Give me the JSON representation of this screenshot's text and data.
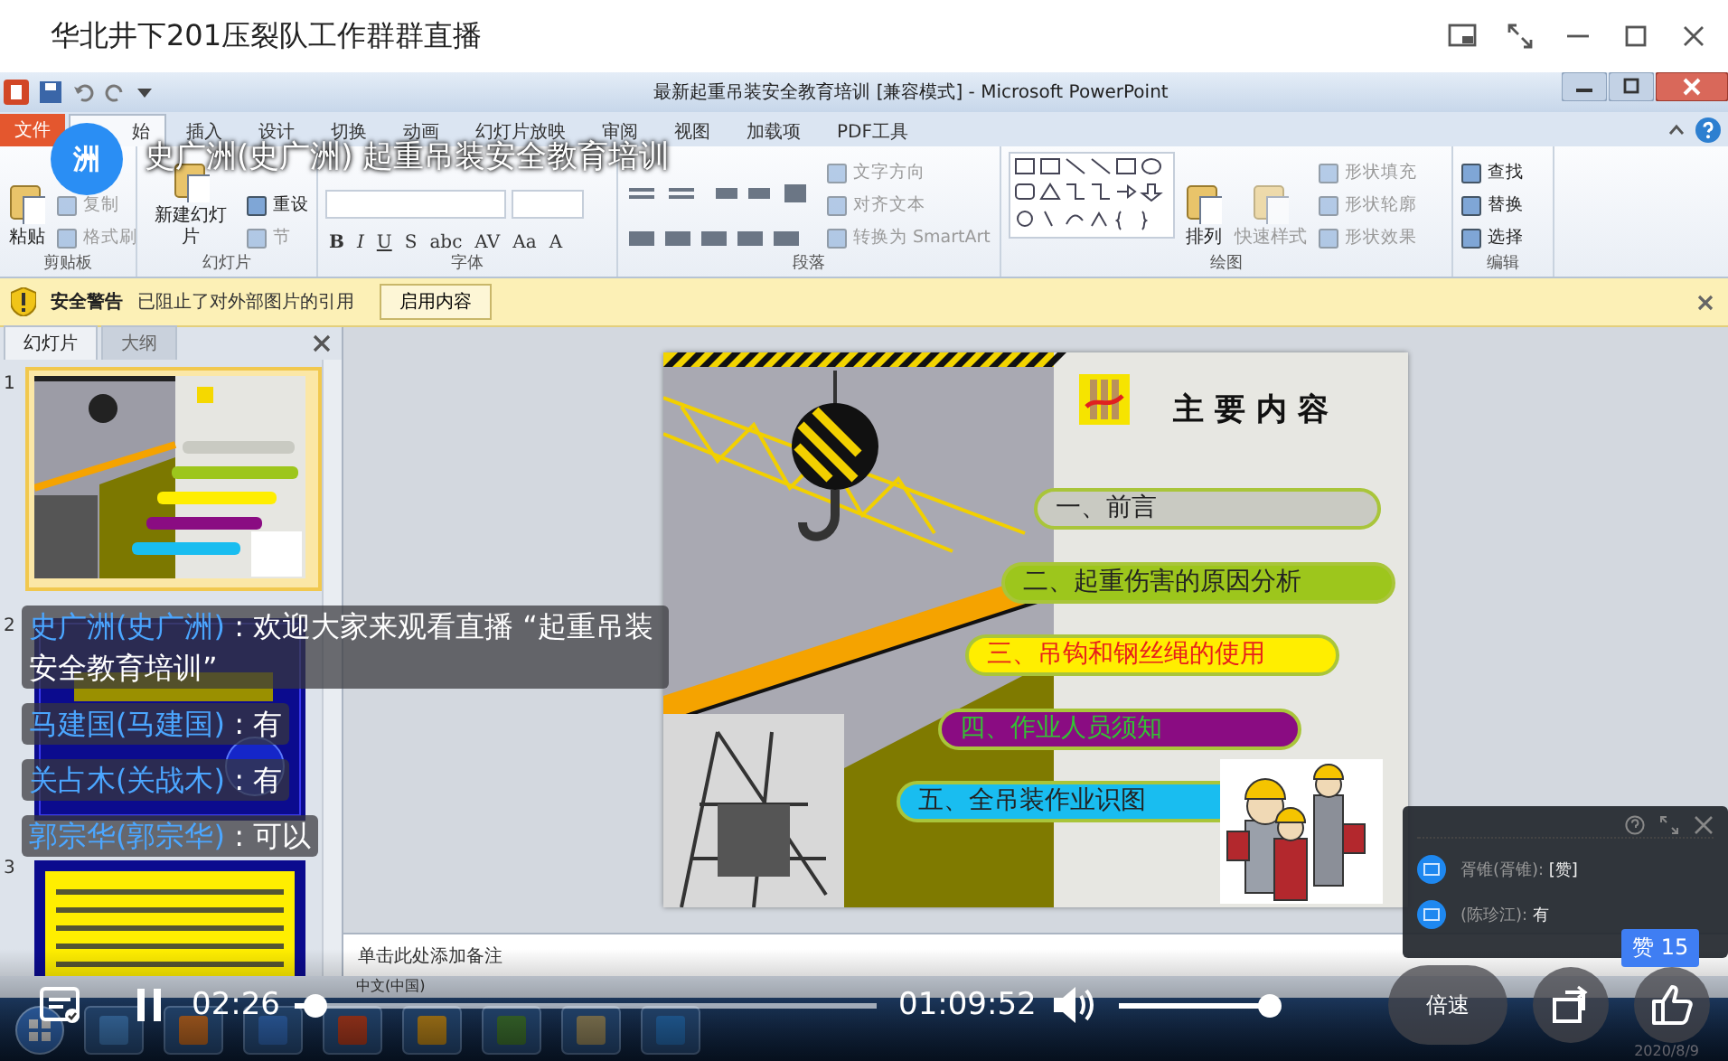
{
  "app": {
    "title": "华北井下201压裂队工作群群直播"
  },
  "ppt": {
    "title": "最新起重吊装安全教育培训 [兼容模式] - Microsoft PowerPoint",
    "file_tab": "文件",
    "tabs": [
      {
        "label": "始",
        "selected": true
      },
      {
        "label": "插入",
        "selected": false
      },
      {
        "label": "设计",
        "selected": false
      },
      {
        "label": "切换",
        "selected": false
      },
      {
        "label": "动画",
        "selected": false
      },
      {
        "label": "幻灯片放映",
        "selected": false
      },
      {
        "label": "审阅",
        "selected": false
      },
      {
        "label": "视图",
        "selected": false
      },
      {
        "label": "加载项",
        "selected": false
      },
      {
        "label": "PDF工具",
        "selected": false
      }
    ],
    "ribbon_groups": [
      {
        "label": "剪贴板",
        "kind": "plain",
        "items": [
          {
            "label": "粘贴",
            "kind": "large",
            "disabled": false
          },
          {
            "label": "复制",
            "kind": "small",
            "disabled": true
          },
          {
            "label": "格式刷",
            "kind": "small",
            "disabled": true
          }
        ]
      },
      {
        "label": "幻灯片",
        "kind": "plain",
        "items": [
          {
            "label": "新建幻灯片",
            "kind": "large",
            "disabled": false
          },
          {
            "label": "重设",
            "kind": "small",
            "disabled": false
          },
          {
            "label": "节",
            "kind": "small",
            "disabled": true
          }
        ]
      },
      {
        "label": "字体",
        "kind": "font",
        "items": [
          {
            "label": "B",
            "kind": "format"
          },
          {
            "label": "I",
            "kind": "format"
          },
          {
            "label": "U",
            "kind": "format"
          },
          {
            "label": "S",
            "kind": "format"
          },
          {
            "label": "abc",
            "kind": "format"
          },
          {
            "label": "AV",
            "kind": "format"
          },
          {
            "label": "Aa",
            "kind": "format"
          },
          {
            "label": "A",
            "kind": "format"
          }
        ]
      },
      {
        "label": "段落",
        "kind": "paragraph",
        "items": [
          {
            "label": "文字方向",
            "kind": "small",
            "disabled": true
          },
          {
            "label": "对齐文本",
            "kind": "small",
            "disabled": true
          },
          {
            "label": "转换为 SmartArt",
            "kind": "small",
            "disabled": true
          }
        ]
      },
      {
        "label": "绘图",
        "kind": "drawing",
        "items": [
          {
            "label": "排列",
            "kind": "large",
            "disabled": false
          },
          {
            "label": "快速样式",
            "kind": "large",
            "disabled": true
          },
          {
            "label": "形状填充",
            "kind": "small",
            "disabled": true
          },
          {
            "label": "形状轮廓",
            "kind": "small",
            "disabled": true
          },
          {
            "label": "形状效果",
            "kind": "small",
            "disabled": true
          }
        ]
      },
      {
        "label": "编辑",
        "kind": "plain",
        "items": [
          {
            "label": "查找",
            "kind": "small",
            "disabled": false
          },
          {
            "label": "替换",
            "kind": "small",
            "disabled": false
          },
          {
            "label": "选择",
            "kind": "small",
            "disabled": false
          }
        ]
      }
    ],
    "security": {
      "label": "安全警告",
      "message": "已阻止了对外部图片的引用",
      "button": "启用内容"
    },
    "panel_tabs": [
      {
        "label": "幻灯片",
        "selected": true
      },
      {
        "label": "大纲",
        "selected": false
      }
    ],
    "thumbnails": [
      {
        "number": "1",
        "kind": "cover",
        "selected": true
      },
      {
        "number": "2",
        "kind": "blue",
        "selected": false
      },
      {
        "number": "3",
        "kind": "text",
        "selected": false
      }
    ],
    "slide": {
      "title": "主要内容",
      "items": [
        {
          "label": "一、前言",
          "color": "#c9cac2",
          "kind": "plain"
        },
        {
          "label": "二、起重伤害的原因分析",
          "color": "#9dc61c",
          "kind": "plain"
        },
        {
          "label": "三、吊钩和钢丝绳的使用",
          "color": "#ffee00",
          "kind": "red"
        },
        {
          "label": "四、作业人员须知",
          "color": "#8a0c82",
          "kind": "green"
        },
        {
          "label": "五、全吊装作业识图",
          "color": "#19bdf0",
          "kind": "plain"
        }
      ]
    },
    "notes": {
      "placeholder": "单击此处添加备注"
    },
    "status_bar": {
      "language": "中文(中国)"
    },
    "taskbar": {
      "date": "2020/8/9"
    }
  },
  "live": {
    "host_initial": "洲",
    "stream_title": "史广洲(史广洲) 起重吊装安全教育培训"
  },
  "chat": [
    {
      "user": "史广洲(史广洲)",
      "text": ": 欢迎大家来观看直播 “起重吊装安全教育培训”"
    },
    {
      "user": "马建国(马建国)",
      "text": ": 有"
    },
    {
      "user": "关占木(关战木)",
      "text": ": 有"
    },
    {
      "user": "郭宗华(郭宗华)",
      "text": ": 可以"
    }
  ],
  "chat_popup": {
    "messages": [
      {
        "user": "胥锥(胥锥):",
        "text": "[赞]"
      },
      {
        "user": "(陈珍江):",
        "text": "有"
      }
    ]
  },
  "player": {
    "playing": true,
    "elapsed": "02:26",
    "total": "01:09:52",
    "progress": {
      "level": 0.035
    },
    "volume": {
      "level": 0.96
    },
    "speed": "倍速",
    "likes": "赞 15"
  }
}
